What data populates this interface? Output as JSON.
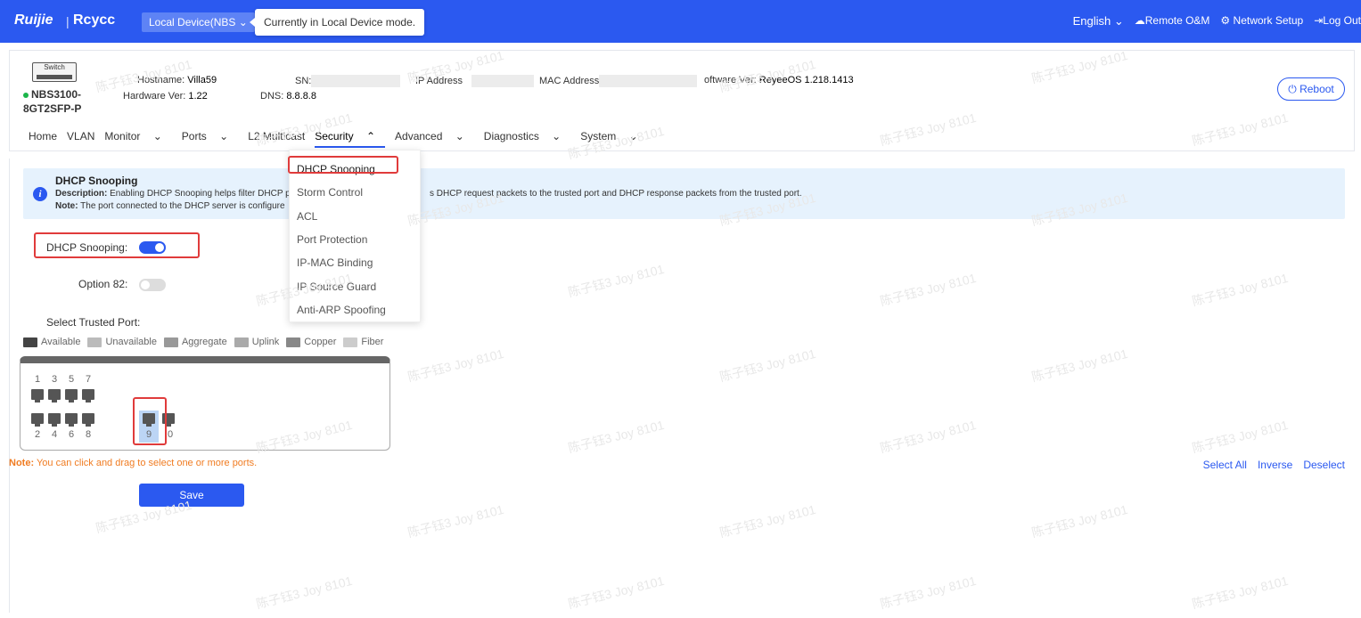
{
  "topbar": {
    "logo": "Ruijie",
    "logo2": "Rcycc",
    "mode_button": "Local Device(NBS",
    "tooltip": "Currently in Local Device mode.",
    "language": "English",
    "remote": "Remote O&M",
    "network_setup": "Network Setup",
    "logout": "Log Out"
  },
  "device": {
    "icon_label": "Switch",
    "model_line1": "NBS3100-",
    "model_line2": "8GT2SFP-P",
    "hostname_label": "Hostname:",
    "hostname": "Villa59",
    "hardware_label": "Hardware Ver:",
    "hardware": "1.22",
    "sn_label": "SN:",
    "dns_label": "DNS:",
    "dns": "8.8.8.8",
    "ip_label": "IP Address",
    "mac_label": "MAC Address",
    "software_label": "oftware Ver:",
    "software": "ReyeeOS 1.218.1413",
    "reboot": "Reboot"
  },
  "nav": {
    "items": [
      "Home",
      "VLAN",
      "Monitor",
      "Ports",
      "L2 Multicast",
      "Security",
      "Advanced",
      "Diagnostics",
      "System"
    ]
  },
  "security_menu": {
    "items": [
      "DHCP Snooping",
      "Storm Control",
      "ACL",
      "Port Protection",
      "IP-MAC Binding",
      "IP Source Guard",
      "Anti-ARP Spoofing"
    ]
  },
  "alert": {
    "title": "DHCP Snooping",
    "desc_label": "Description:",
    "desc": "Enabling DHCP Snooping helps filter DHCP p",
    "desc_tail": "s DHCP request packets to the trusted port and DHCP response packets from the trusted port.",
    "note_label": "Note:",
    "note": "The port connected to the DHCP server is configure"
  },
  "form": {
    "dhcp_label": "DHCP Snooping:",
    "dhcp_on": true,
    "opt82_label": "Option 82:",
    "opt82_on": false,
    "trusted_label": "Select Trusted Port:"
  },
  "legend": [
    "Available",
    "Unavailable",
    "Aggregate",
    "Uplink",
    "Copper",
    "Fiber"
  ],
  "ports": {
    "top": [
      "1",
      "3",
      "5",
      "7"
    ],
    "bottom": [
      "2",
      "4",
      "6",
      "8"
    ],
    "sfp": [
      "9",
      "0"
    ]
  },
  "note": {
    "label": "Note:",
    "text": "You can click and drag to select one or more ports."
  },
  "actions": [
    "Select All",
    "Inverse",
    "Deselect"
  ],
  "save": "Save",
  "watermark": "陈子钰3 Joy 8101"
}
